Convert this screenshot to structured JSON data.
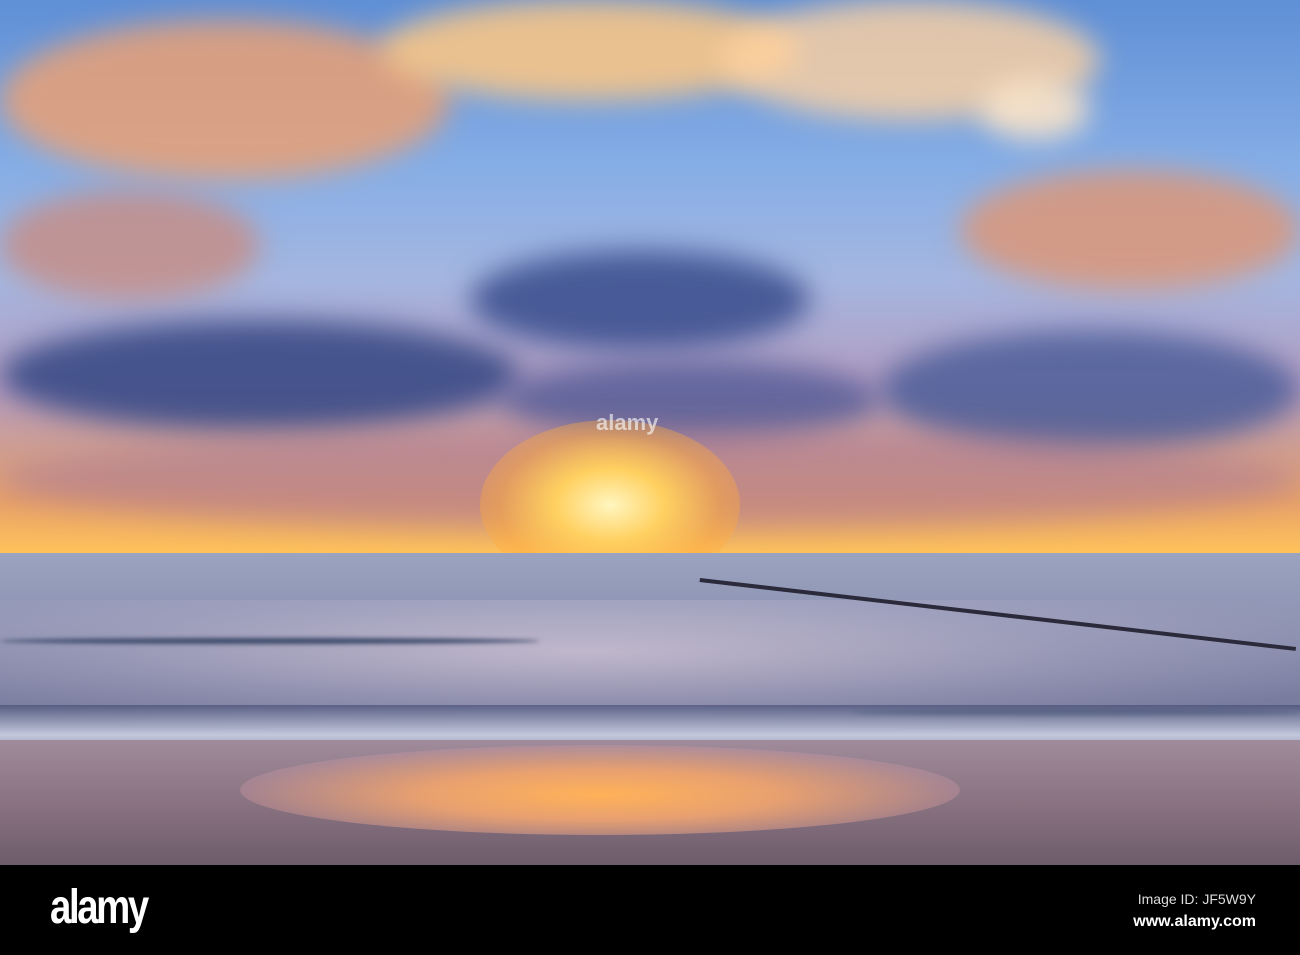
{
  "watermark": {
    "logo": "alamy",
    "overlay": "alamy"
  },
  "footer": {
    "image_id": "Image ID: JF5W9Y",
    "website": "www.alamy.com"
  },
  "colors": {
    "sky_top": "#5f8fd6",
    "cloud_orange": "#f7b46a",
    "cloud_dark": "#3a4a86",
    "sun": "#ffd060",
    "sea": "#8e93b2",
    "sand": "#8a7381"
  }
}
